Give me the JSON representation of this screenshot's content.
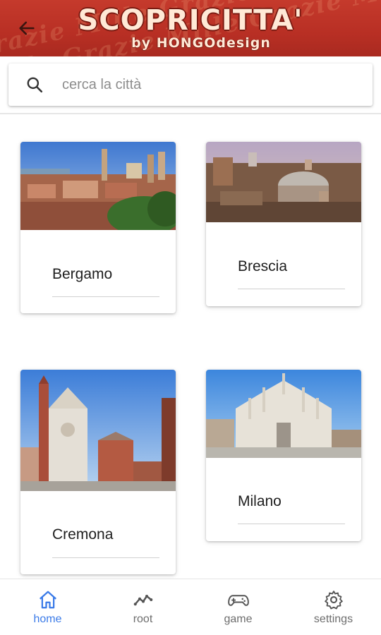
{
  "header": {
    "title": "SCOPRICITTA'",
    "subtitle": "by HONGOdesign",
    "back_icon": "arrow-left-icon"
  },
  "search": {
    "placeholder": "cerca la città",
    "value": "",
    "icon": "search-icon"
  },
  "cities": [
    {
      "name": "Bergamo"
    },
    {
      "name": "Brescia"
    },
    {
      "name": "Cremona"
    },
    {
      "name": "Milano"
    }
  ],
  "nav": {
    "items": [
      {
        "label": "home",
        "icon": "home-icon",
        "active": true
      },
      {
        "label": "root",
        "icon": "trend-icon",
        "active": false
      },
      {
        "label": "game",
        "icon": "gamepad-icon",
        "active": false
      },
      {
        "label": "settings",
        "icon": "gear-icon",
        "active": false
      }
    ]
  },
  "colors": {
    "header_bg": "#b82f24",
    "accent": "#3b7be8",
    "inactive": "#6d6d6d"
  }
}
